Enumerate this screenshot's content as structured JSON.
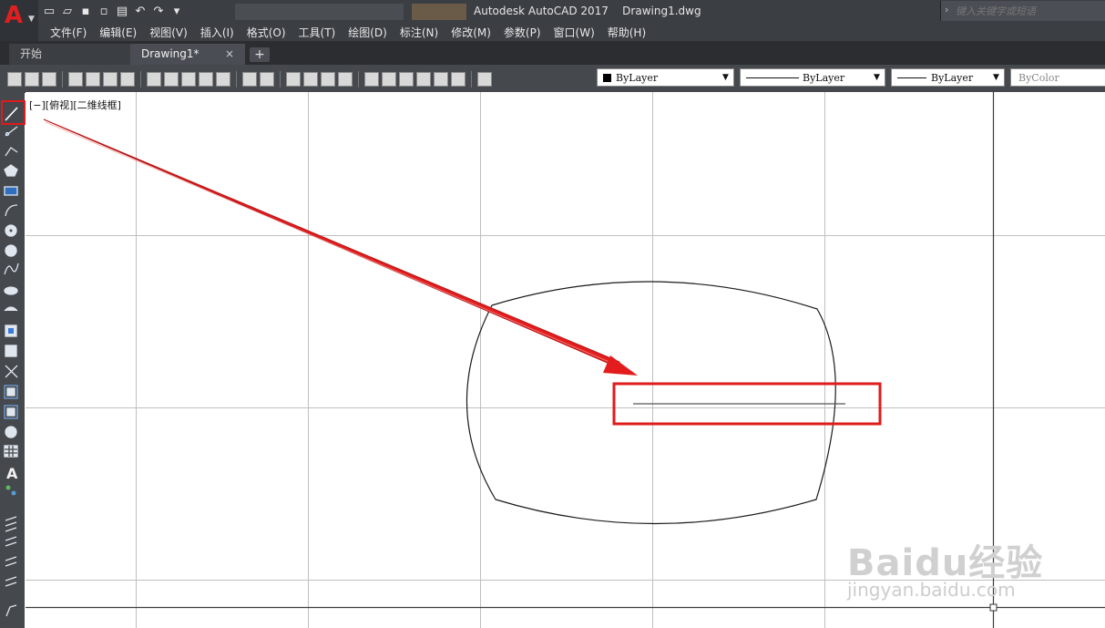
{
  "window": {
    "title": "Autodesk AutoCAD 2017    Drawing1.dwg",
    "search_placeholder": "键入关键字或短语"
  },
  "app_menu": {
    "logo_letter": "A"
  },
  "menubar": {
    "items": [
      "文件(F)",
      "编辑(E)",
      "视图(V)",
      "插入(I)",
      "格式(O)",
      "工具(T)",
      "绘图(D)",
      "标注(N)",
      "修改(M)",
      "参数(P)",
      "窗口(W)",
      "帮助(H)"
    ]
  },
  "tabs": {
    "start": "开始",
    "drawing": "Drawing1*",
    "close_glyph": "×",
    "add_glyph": "+"
  },
  "properties": {
    "layer": "ByLayer",
    "linetype": "ByLayer",
    "lineweight": "ByLayer",
    "color": "ByColor"
  },
  "viewport": {
    "label": "[−][俯视][二维线框]"
  },
  "watermark": {
    "brand": "Baidu经验",
    "url": "jingyan.baidu.com"
  },
  "annotations": {
    "highlight_color": "#e01b1b",
    "arrow_color": "#e01b1b"
  }
}
